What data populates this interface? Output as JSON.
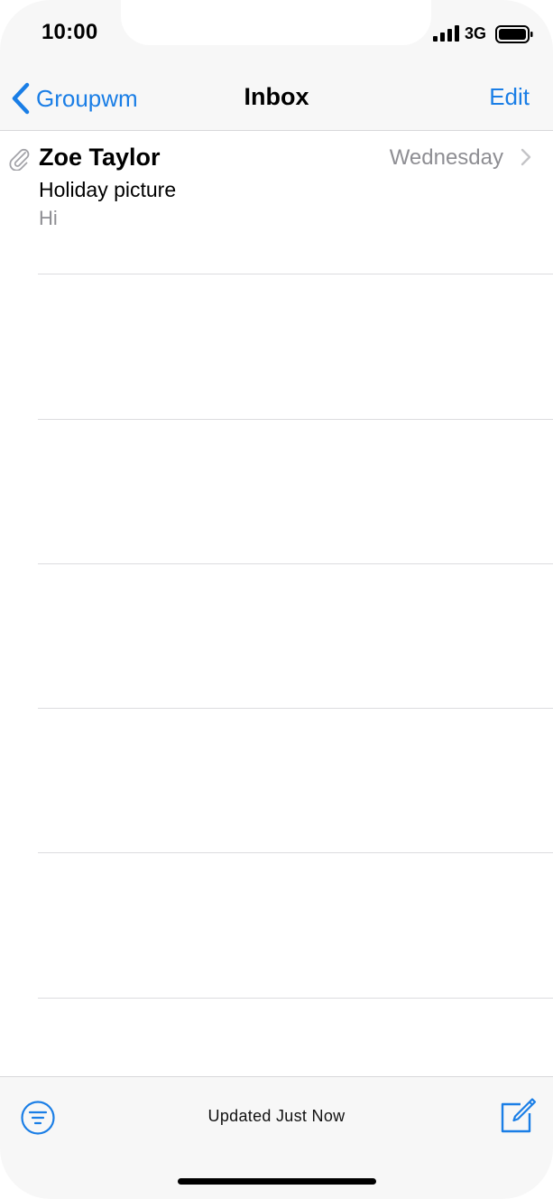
{
  "status_bar": {
    "time": "10:00",
    "network": "3G",
    "signal_icon": "signal-bars-icon",
    "battery_icon": "battery-full-icon"
  },
  "nav": {
    "back_label": "Groupwm",
    "title": "Inbox",
    "edit_label": "Edit"
  },
  "messages": [
    {
      "sender": "Zoe Taylor",
      "date": "Wednesday",
      "subject": "Holiday picture",
      "preview": "Hi",
      "has_attachment": true
    }
  ],
  "toolbar": {
    "status": "Updated Just Now",
    "filter_icon": "filter-icon",
    "compose_icon": "compose-icon"
  },
  "colors": {
    "accent": "#1a7ee6",
    "secondary_text": "#8e8e93",
    "bar_background": "#f7f7f7",
    "separator": "#dcdcdf"
  }
}
